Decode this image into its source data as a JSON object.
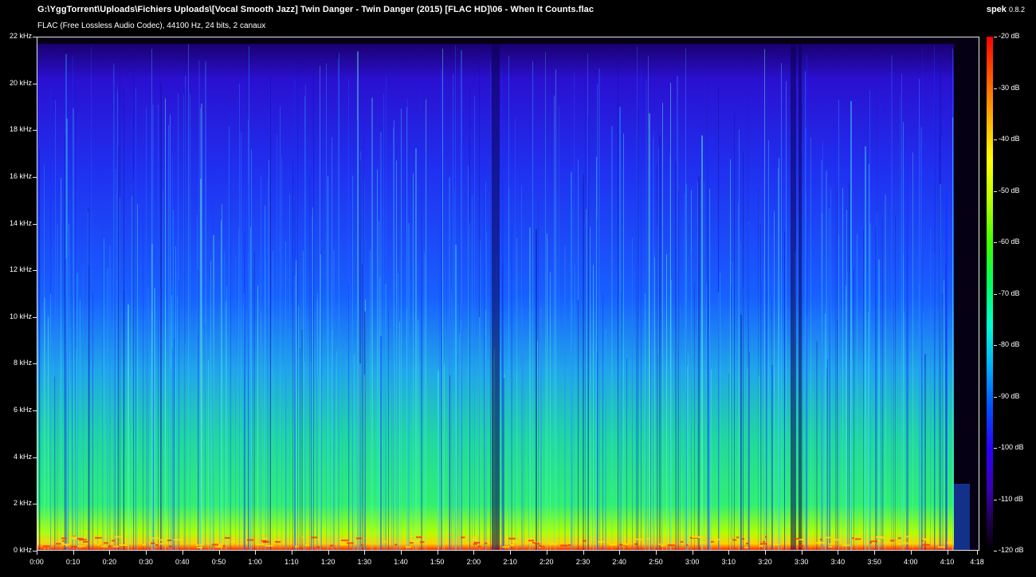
{
  "header": {
    "file_path": "G:\\YggTorrent\\Uploads\\Fichiers Uploads\\[Vocal Smooth Jazz] Twin Danger - Twin Danger (2015) [FLAC HD]\\06 - When It Counts.flac",
    "codec_info": "FLAC (Free Lossless Audio Codec), 44100 Hz, 24 bits, 2 canaux"
  },
  "app": {
    "name": "spek",
    "version": "0.8.2"
  },
  "axes": {
    "frequency_labels": [
      "22 kHz",
      "20 kHz",
      "18 kHz",
      "16 kHz",
      "14 kHz",
      "12 kHz",
      "10 kHz",
      "8 kHz",
      "6 kHz",
      "4 kHz",
      "2 kHz",
      "0 kHz"
    ],
    "time_labels": [
      "0:00",
      "0:10",
      "0:20",
      "0:30",
      "0:40",
      "0:50",
      "1:00",
      "1:10",
      "1:20",
      "1:30",
      "1:40",
      "1:50",
      "2:00",
      "2:10",
      "2:20",
      "2:30",
      "2:40",
      "2:50",
      "3:00",
      "3:10",
      "3:20",
      "3:30",
      "3:40",
      "3:50",
      "4:00",
      "4:10",
      "4:18"
    ],
    "db_labels": [
      "-20 dB",
      "-30 dB",
      "-40 dB",
      "-50 dB",
      "-60 dB",
      "-70 dB",
      "-80 dB",
      "-90 dB",
      "-100 dB",
      "-110 dB",
      "-120 dB"
    ]
  },
  "colors": {
    "background": "#000000",
    "spectrum_high": "#ff0000",
    "spectrum_mid": "#00ff60",
    "spectrum_low": "#2a00ff"
  }
}
